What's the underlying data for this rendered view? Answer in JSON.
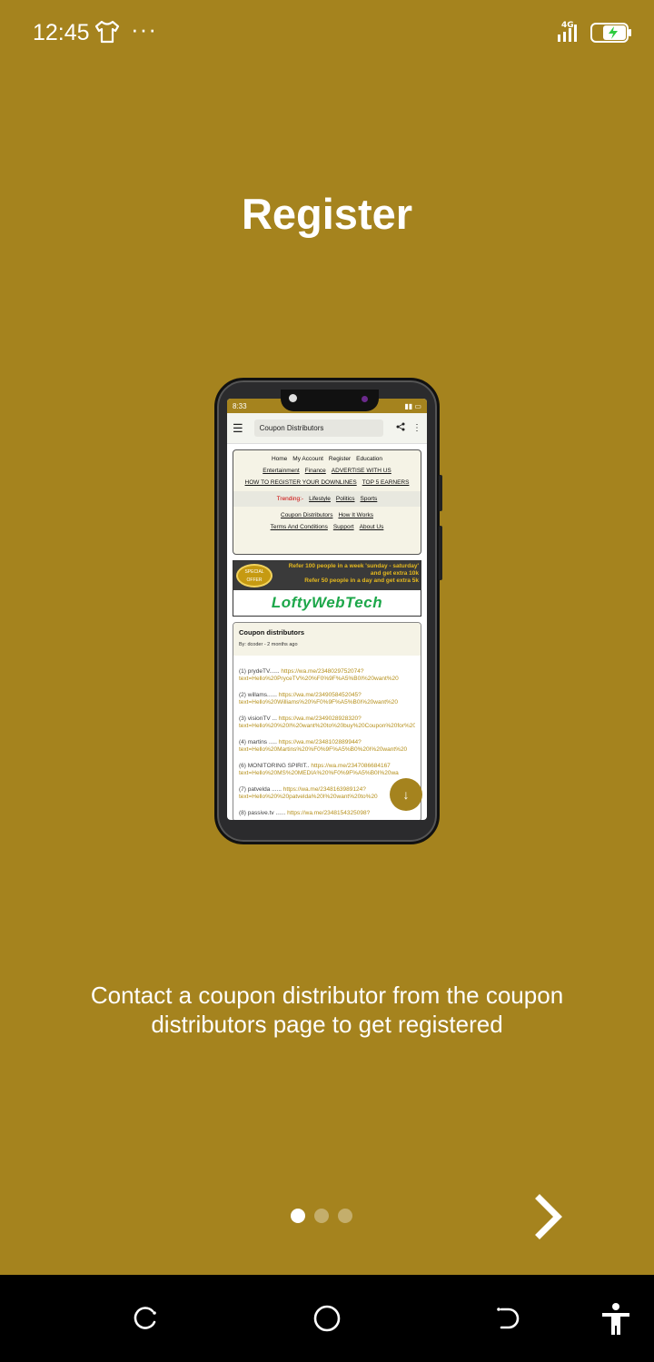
{
  "status_bar": {
    "time": "12:45",
    "more_dots": "···",
    "network": "4G"
  },
  "title": "Register",
  "phone_mockup": {
    "status_time": "8:33",
    "url": "Coupon Distributors",
    "nav_row1": [
      "Home",
      "My Account",
      "Register",
      "Education"
    ],
    "nav_row2": [
      "Entertainment",
      "Finance",
      "ADVERTISE WITH US"
    ],
    "nav_row3": [
      "HOW TO REGISTER YOUR DOWNLINES",
      "TOP 5 EARNERS"
    ],
    "trending_label": "Trending:-",
    "trending_items": [
      "Lifestyle",
      "Politics",
      "Sports"
    ],
    "nav_row4": [
      "Coupon Distributors",
      "How It Works"
    ],
    "nav_row5": [
      "Terms And Conditions",
      "Support",
      "About Us"
    ],
    "ad_offer": "SPECIAL OFFER",
    "ad_line1": "Refer 100 people in a week 'sunday - saturday' and get extra 10k",
    "ad_line2": "Refer 50 people in a day and get extra 5k",
    "ad_logo": "LoftyWebTech",
    "card_title": "Coupon distributors",
    "card_by": "By: dcoder - 2 months ago",
    "items": [
      {
        "label": "(1) prydeTV......",
        "link": "https://wa.me/2348029752074?",
        "sub": "text=Hello%20PryceTV%20%F0%9F%A5%B0I%20want%20"
      },
      {
        "label": "(2) willams......",
        "link": "https://wa.me/2349058452045?",
        "sub": "text=Hello%20Williams%20%F0%9F%A5%B0I%20want%20"
      },
      {
        "label": "(3) visionTV ...",
        "link": "https://wa.me/2349028928320?",
        "sub": "text=Hello%20%20I%20want%20to%20buy%20Coupon%20for%20"
      },
      {
        "label": "(4) martins .....",
        "link": "https://wa.me/2348102889944?",
        "sub": "text=Hello%20Martins%20%F0%9F%A5%B0%20I%20want%20"
      },
      {
        "label": "(6) MONITORING SPIRIT..",
        "link": "https://wa.me/2347086684167",
        "sub": "text=Hello%20MS%20MEDIA%20%F0%9F%A5%B0I%20wa"
      },
      {
        "label": "(7) patvelda ......",
        "link": "https://wa.me/2348163989124?",
        "sub": "text=Hello%20%20patvelda%20I%20want%20to%20"
      },
      {
        "label": "(8) passive.tv ......",
        "link": "https://wa.me/2348154325098?",
        "sub": ""
      }
    ]
  },
  "description": "Contact a coupon distributor from the coupon distributors page to get registered",
  "pager": {
    "total": 3,
    "active": 0
  },
  "colors": {
    "background": "#a5831e",
    "text": "#ffffff",
    "navbar": "#000000"
  },
  "icons": [
    "tshirt-icon",
    "signal-icon",
    "battery-charging-icon",
    "chevron-right-icon",
    "recents-icon",
    "home-icon",
    "back-icon",
    "accessibility-icon"
  ]
}
